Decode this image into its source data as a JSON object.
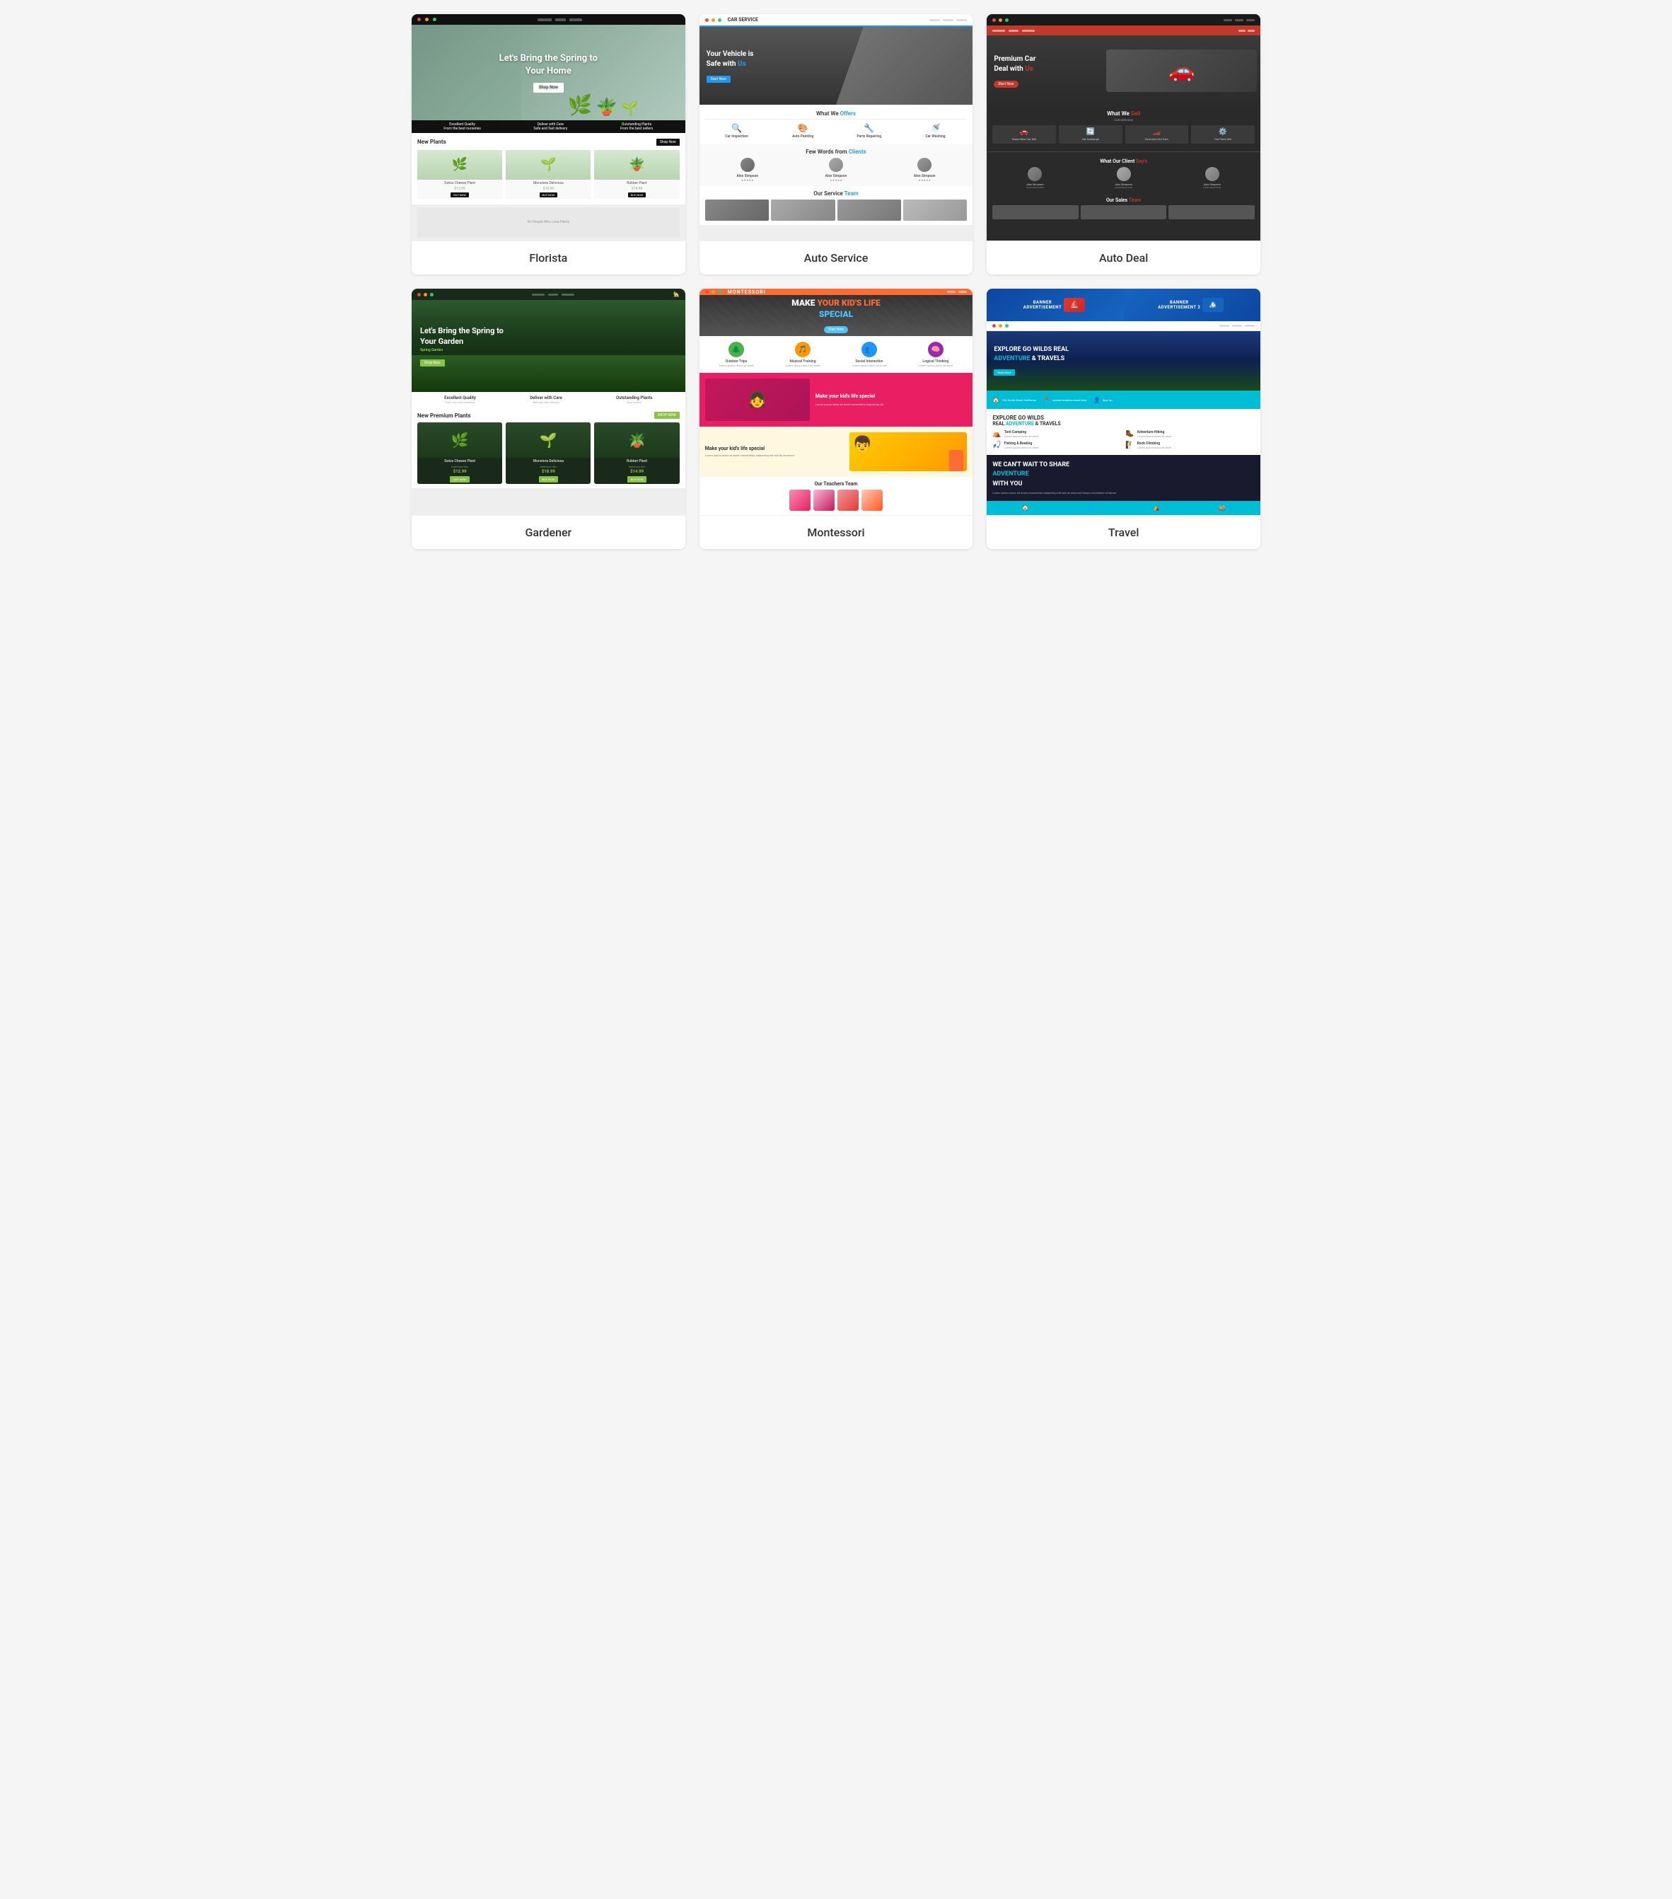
{
  "cards": [
    {
      "id": "florista",
      "label": "Florista",
      "hero": {
        "line1": "Let's Bring the Spring to",
        "line2": "Your Home",
        "btn": "Shop Now"
      },
      "plants": {
        "title": "New Plants",
        "shopBtn": "Shop Now",
        "items": [
          {
            "name": "Swiss Cheese Plant",
            "price": "$12.99",
            "emoji": "🌿"
          },
          {
            "name": "Monstera Deliciosa",
            "price": "$18.99",
            "emoji": "🌱"
          },
          {
            "name": "Rubber Plant",
            "price": "$14.99",
            "emoji": "🪴"
          }
        ]
      },
      "stats": [
        {
          "title": "Excellent Quality",
          "desc": "From the best nurseries"
        },
        {
          "title": "Deliver with Care",
          "desc": "Safe and fast delivery"
        },
        {
          "title": "Outstanding Plants",
          "desc": "From the best sellers"
        }
      ]
    },
    {
      "id": "autoservice",
      "label": "Auto Service",
      "nav": "CAR SERVICE",
      "hero": {
        "line1": "Your Vehicle is",
        "line2": "Safe with",
        "highlight": "Us",
        "btn": "Start Now"
      },
      "section_title": "What We",
      "section_highlight": "Offers",
      "services": [
        {
          "name": "Car Inspection",
          "emoji": "🔍"
        },
        {
          "name": "Auto Painting",
          "emoji": "🎨"
        },
        {
          "name": "Parts Repairing",
          "emoji": "🔧"
        },
        {
          "name": "Car Washing",
          "emoji": "🚿"
        }
      ],
      "testimonials_title": "Few Words from",
      "testimonials_highlight": "Clients",
      "testimonials": [
        {
          "name": "Alex Simpson"
        },
        {
          "name": "Alex Simpson"
        },
        {
          "name": "Alex Simpson"
        }
      ],
      "team_title": "Our Service",
      "team_highlight": "Team"
    },
    {
      "id": "autodeal",
      "label": "Auto Deal",
      "hero": {
        "line1": "Premium Car",
        "line2": "Deal with",
        "highlight": "Us",
        "btn": "Start Now"
      },
      "sell_title": "What We",
      "sell_highlight": "Sell",
      "sell_items": [
        {
          "name": "Brand New Car Sell",
          "emoji": "🚗"
        },
        {
          "name": "Car Exchange",
          "emoji": "🔄"
        },
        {
          "name": "Exclusive Old Cars",
          "emoji": "🏎️"
        },
        {
          "name": "Car Parts Sell",
          "emoji": "⚙️"
        }
      ],
      "client_title": "What Our Client",
      "client_highlight": "Say's",
      "clients": [
        {
          "name": "Alex Simpson"
        },
        {
          "name": "Alex Simpson"
        },
        {
          "name": "Alex Simpson"
        }
      ],
      "team_title": "Our Sales",
      "team_highlight": "Team"
    },
    {
      "id": "gardener",
      "label": "Gardener",
      "hero": {
        "line1": "Let's Bring the Spring to",
        "line2": "Your Garden",
        "sub": "Spring Garden",
        "btn": "Shop Now"
      },
      "plants": {
        "title": "New Premium Plants",
        "shopBtn": "SHOP NOW",
        "items": [
          {
            "name": "Swiss Cheese Plant",
            "sub": "Delicious Rex",
            "price": "$12.99",
            "emoji": "🌿"
          },
          {
            "name": "Monstera Deliciosa",
            "sub": "Delicious Rex",
            "price": "$18.99",
            "emoji": "🌱"
          },
          {
            "name": "Rubber Plant",
            "sub": "Delicious Rex",
            "price": "$14.99",
            "emoji": "🪴"
          }
        ]
      },
      "stats": [
        {
          "title": "Excellent Quality"
        },
        {
          "title": "Deliver with Care"
        },
        {
          "title": "Outstanding Plants"
        }
      ]
    },
    {
      "id": "montessori",
      "label": "Montessori",
      "nav": "MONTESSORI",
      "hero": {
        "line1": "MAKE",
        "highlight1": "YOUR KID'S LIFE",
        "highlight2": "SPECIAL",
        "btn": "Start Now"
      },
      "features": [
        {
          "name": "Outdoor Trips",
          "emoji": "🌲",
          "color": "#4caf50"
        },
        {
          "name": "Musical Training",
          "emoji": "🎵",
          "color": "#ff9800"
        },
        {
          "name": "Social Interaction",
          "emoji": "👥",
          "color": "#2196f3"
        },
        {
          "name": "Logical Thinking",
          "emoji": "🧠",
          "color": "#9c27b0"
        }
      ],
      "pink_section": {
        "title": "Make your kid's life special",
        "desc": "Lorem ipsum dolor sit amet consectetur adipiscing elit"
      },
      "kids_section": {
        "title": "Make your kid's life special",
        "desc": "Lorem ipsum dolor sit amet consectetur adipiscing elit sed do eiusmod"
      },
      "teachers_title": "Our Teachers Team"
    },
    {
      "id": "travel",
      "label": "Travel",
      "hero": {
        "line1": "EXPLORE GO WILDS REAL",
        "highlight": "ADVENTURE",
        "line2": "& TRAVELS",
        "btn": "Read More"
      },
      "bar_items": [
        {
          "label": "🏠 123, Smith Street California"
        },
        {
          "label": "📍 contact address email here"
        },
        {
          "label": "👤 Sign Up"
        }
      ],
      "features_title": "EXPLORE GO WILDS",
      "features_sub1": "REAL",
      "features_highlight": "ADVENTURE",
      "features_sub2": "& TRAVELS",
      "features": [
        {
          "name": "Tent Camping",
          "emoji": "⛺"
        },
        {
          "name": "Adventure Hiking",
          "emoji": "🥾"
        },
        {
          "name": "Fishing & Boating",
          "emoji": "🎣"
        },
        {
          "name": "Rock Climbing",
          "emoji": "🧗"
        }
      ],
      "dark_title": "WE CAN'T WAIT TO SHARE",
      "dark_highlight": "ADVENTURE",
      "dark_sub": "WITH YOU",
      "footer_icons": [
        "🏠",
        "🌐",
        "⛺",
        "🚵"
      ]
    }
  ]
}
